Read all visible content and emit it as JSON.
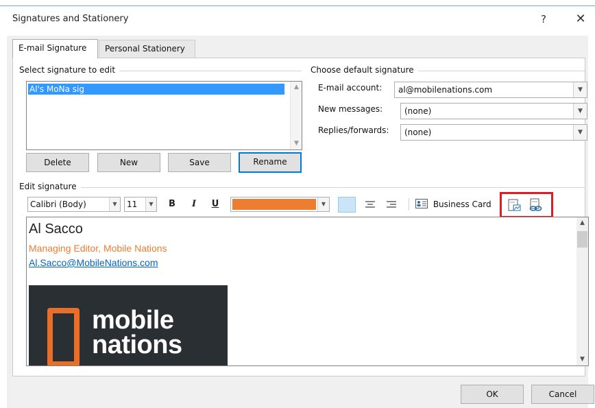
{
  "window": {
    "title": "Signatures and Stationery",
    "help_glyph": "?",
    "close_glyph": "✕"
  },
  "tabs": [
    {
      "label": "E-mail Signature",
      "active": true
    },
    {
      "label": "Personal Stationery",
      "active": false
    }
  ],
  "select_signature": {
    "group_label": "Select signature to edit",
    "items": [
      "Al's MoNa sig"
    ],
    "selected_index": 0,
    "buttons": {
      "delete": "Delete",
      "new": "New",
      "save": "Save",
      "rename": "Rename"
    }
  },
  "default_signature": {
    "group_label": "Choose default signature",
    "email_account_label": "E-mail account:",
    "email_account_value": "al@mobilenations.com",
    "new_messages_label": "New messages:",
    "new_messages_value": "(none)",
    "replies_label": "Replies/forwards:",
    "replies_value": "(none)"
  },
  "edit_signature": {
    "group_label": "Edit signature",
    "font": "Calibri (Body)",
    "size": "11",
    "bold": "B",
    "italic": "I",
    "underline": "U",
    "font_color": "#ed7d31",
    "business_card_label": "Business Card",
    "toolbar_icons": [
      "align-left-icon",
      "align-center-icon",
      "align-right-icon",
      "business-card-icon",
      "insert-picture-icon",
      "insert-hyperlink-icon"
    ]
  },
  "signature_content": {
    "name": "Al Sacco",
    "title": "Managing Editor, Mobile Nations",
    "email": "Al.Sacco@MobileNations.com",
    "logo_line1": "mobile",
    "logo_line2": "nations"
  },
  "footer": {
    "ok": "OK",
    "cancel": "Cancel"
  },
  "colors": {
    "selection": "#3399ff",
    "accent_orange": "#ed7d31",
    "highlight_box": "#e11b22",
    "link_blue": "#0563c1"
  }
}
